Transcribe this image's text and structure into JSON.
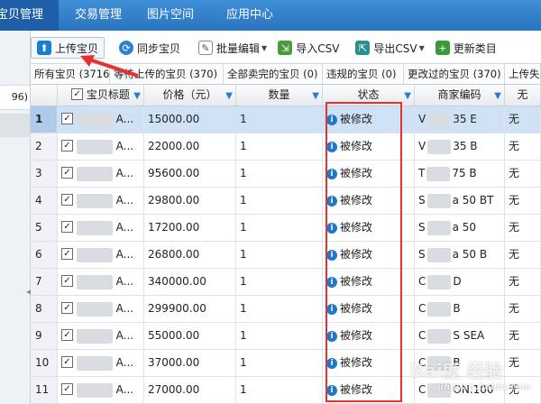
{
  "topnav": {
    "tabs": [
      {
        "label": "宝贝管理",
        "active": true
      },
      {
        "label": "交易管理",
        "active": false
      },
      {
        "label": "图片空间",
        "active": false
      },
      {
        "label": "应用中心",
        "active": false
      }
    ]
  },
  "left_panel": {
    "count_fragment": "96)"
  },
  "toolbar": {
    "upload_label": "上传宝贝",
    "sync_label": "同步宝贝",
    "batch_edit_label": "批量编辑",
    "import_csv_label": "导入CSV",
    "export_csv_label": "导出CSV",
    "update_category_label": "更新类目"
  },
  "filter_tabs": [
    "所有宝贝 (3716)",
    "等待上传的宝贝 (370)",
    "全部卖完的宝贝 (0)",
    "违规的宝贝 (0)",
    "更改过的宝贝 (370)",
    "上传失"
  ],
  "columns": {
    "title": "宝贝标题",
    "price": "价格（元）",
    "quantity": "数量",
    "status": "状态",
    "merchant_code": "商家编码",
    "extra": "无"
  },
  "rows": [
    {
      "n": "1",
      "checked": true,
      "title_tail": "A...",
      "price": "15000.00",
      "qty": "1",
      "status": "被修改",
      "code_head": "V",
      "code_tail": "35 E",
      "extra": "无",
      "selected": true
    },
    {
      "n": "2",
      "checked": true,
      "title_tail": "A...",
      "price": "22000.00",
      "qty": "1",
      "status": "被修改",
      "code_head": "V",
      "code_tail": "35 B",
      "extra": "无",
      "selected": false
    },
    {
      "n": "3",
      "checked": true,
      "title_tail": "A...",
      "price": "95600.00",
      "qty": "1",
      "status": "被修改",
      "code_head": "T",
      "code_tail": "75 B",
      "extra": "无",
      "selected": false
    },
    {
      "n": "4",
      "checked": true,
      "title_tail": "A...",
      "price": "29800.00",
      "qty": "1",
      "status": "被修改",
      "code_head": "S",
      "code_tail": "a 50 BT",
      "extra": "无",
      "selected": false
    },
    {
      "n": "5",
      "checked": true,
      "title_tail": "A...",
      "price": "17200.00",
      "qty": "1",
      "status": "被修改",
      "code_head": "S",
      "code_tail": "a 50",
      "extra": "无",
      "selected": false
    },
    {
      "n": "6",
      "checked": true,
      "title_tail": "A...",
      "price": "26800.00",
      "qty": "1",
      "status": "被修改",
      "code_head": "S",
      "code_tail": "a 50 B",
      "extra": "无",
      "selected": false
    },
    {
      "n": "7",
      "checked": true,
      "title_tail": "A...",
      "price": "340000.00",
      "qty": "1",
      "status": "被修改",
      "code_head": "C",
      "code_tail": "D",
      "extra": "无",
      "selected": false
    },
    {
      "n": "8",
      "checked": true,
      "title_tail": "A...",
      "price": "299900.00",
      "qty": "1",
      "status": "被修改",
      "code_head": "C",
      "code_tail": "B",
      "extra": "无",
      "selected": false
    },
    {
      "n": "9",
      "checked": true,
      "title_tail": "A...",
      "price": "55000.00",
      "qty": "1",
      "status": "被修改",
      "code_head": "C",
      "code_tail": "S SEA",
      "extra": "无",
      "selected": false
    },
    {
      "n": "10",
      "checked": true,
      "title_tail": "A...",
      "price": "37000.00",
      "qty": "1",
      "status": "被修改",
      "code_head": "C",
      "code_tail": "B",
      "extra": "无",
      "selected": false
    },
    {
      "n": "11",
      "checked": true,
      "title_tail": "A...",
      "price": "27000.00",
      "qty": "1",
      "status": "被修改",
      "code_head": "C",
      "code_tail": "ON.100",
      "extra": "无",
      "selected": false
    }
  ],
  "watermark": {
    "text": "Bai度 经验",
    "sub": "jingyan.baidu.com"
  },
  "colors": {
    "nav": "#2b74bf",
    "selected_row": "#cfe1f5",
    "annotation": "#e83030",
    "info_icon": "#1e78d0"
  }
}
